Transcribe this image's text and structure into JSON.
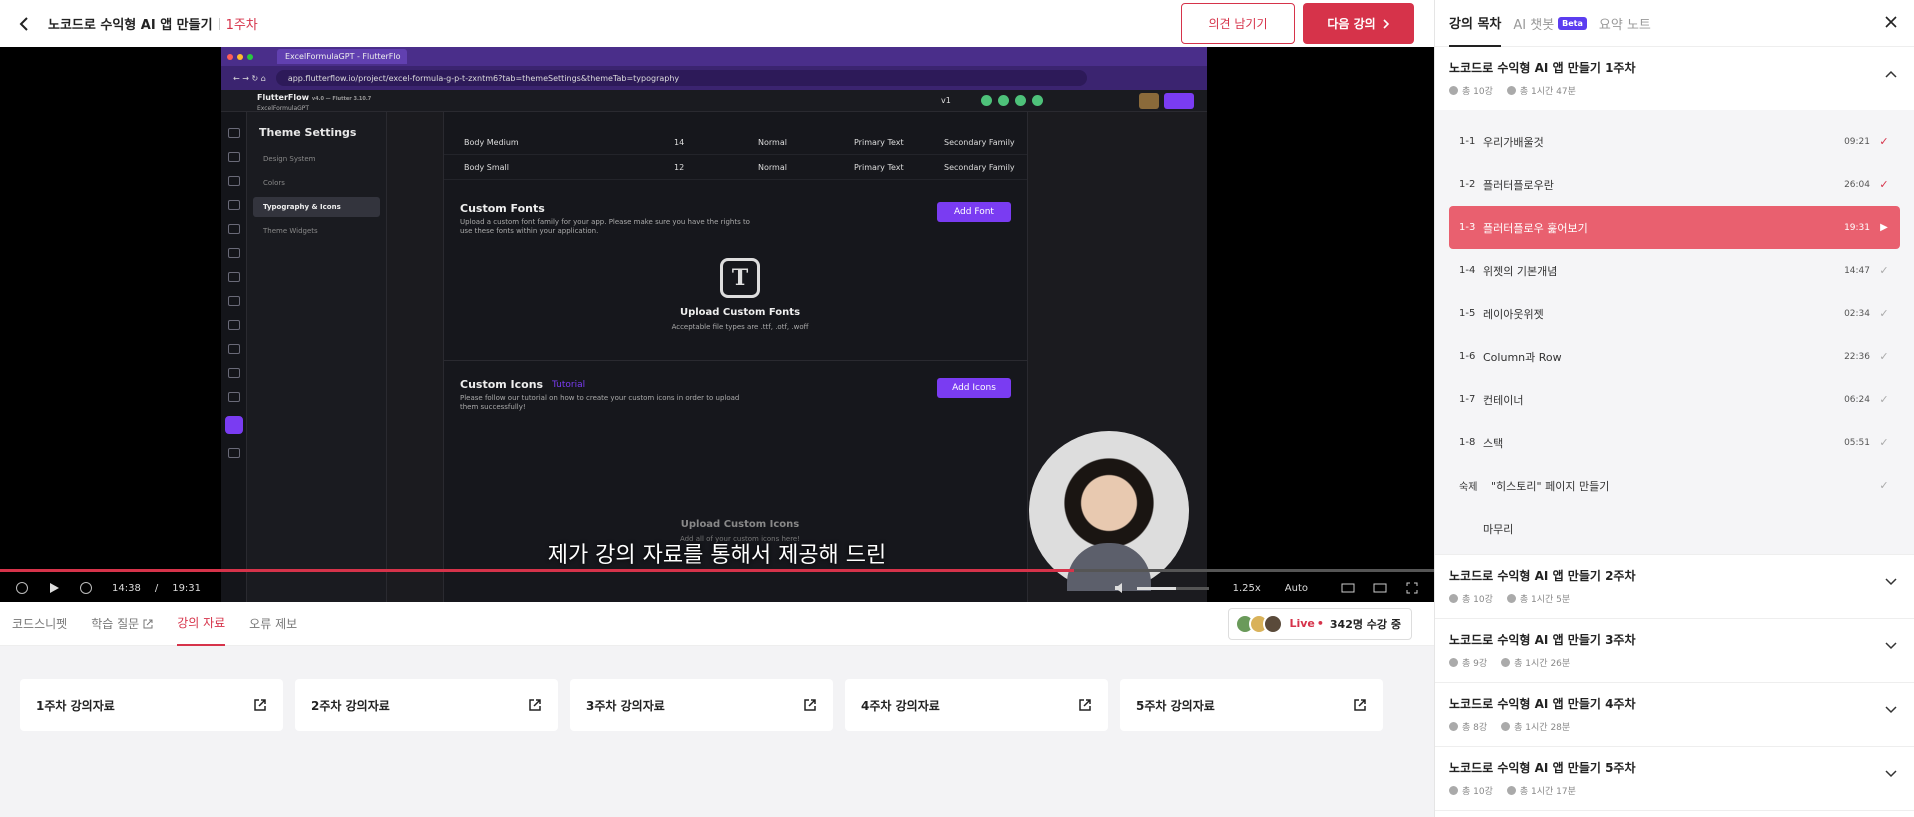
{
  "header": {
    "course_title": "노코드로 수익형 AI 앱 만들기",
    "week": "1주차",
    "feedback_btn": "의견 남기기",
    "next_btn": "다음 강의"
  },
  "video": {
    "browser_tab": "ExcelFormulaGPT - FlutterFlo",
    "url": "app.flutterflow.io/project/excel-formula-g-p-t-zxntm6?tab=themeSettings&themeTab=typography",
    "ff_brand": "FlutterFlow",
    "ff_version": "v4.0 — Flutter 3.10.7",
    "ff_project": "ExcelFormulaGPT",
    "version_tag": "v1",
    "theme_title": "Theme Settings",
    "side_items": [
      "Design System",
      "Colors",
      "Typography & Icons",
      "Theme Widgets"
    ],
    "rows": [
      {
        "name": "Body Medium",
        "size": "14",
        "weight": "Normal",
        "color": "Primary Text",
        "family": "Secondary Family"
      },
      {
        "name": "Body Small",
        "size": "12",
        "weight": "Normal",
        "color": "Primary Text",
        "family": "Secondary Family"
      }
    ],
    "custom_fonts_title": "Custom Fonts",
    "custom_fonts_desc": "Upload a custom font family for your app. Please make sure you have the rights to use these fonts within your application.",
    "add_font": "Add Font",
    "upload_fonts_title": "Upload Custom Fonts",
    "upload_fonts_desc": "Acceptable file types are .ttf, .otf, .woff",
    "custom_icons_title": "Custom Icons",
    "tutorial": "Tutorial",
    "custom_icons_desc": "Please follow our tutorial on how to create your custom icons in order to upload them successfully!",
    "add_icons": "Add Icons",
    "upload_icons_title": "Upload Custom Icons",
    "upload_icons_desc": "Add all of your custom icons here!",
    "subtitle": "제가 강의 자료를 통해서 제공해 드린",
    "current_time": "14:38",
    "time_sep": "/",
    "duration": "19:31",
    "progress": 0.749,
    "volume": 0.55,
    "speed": "1.25x",
    "quality": "Auto"
  },
  "tabs": [
    {
      "label": "코드스니펫"
    },
    {
      "label": "학습 질문"
    },
    {
      "label": "강의 자료"
    },
    {
      "label": "오류 제보"
    }
  ],
  "live": {
    "label": "Live",
    "dot": "•",
    "count": "342명 수강 중"
  },
  "materials": [
    "1주차 강의자료",
    "2주차 강의자료",
    "3주차 강의자료",
    "4주차 강의자료",
    "5주차 강의자료"
  ],
  "panel": {
    "tabs": {
      "toc": "강의 목차",
      "ai": "AI 챗봇",
      "beta": "Beta",
      "notes": "요약 노트"
    },
    "weeks": [
      {
        "title": "노코드로 수익형 AI 앱 만들기 1주차",
        "count": "총 10강",
        "time": "총 1시간 47분"
      },
      {
        "title": "노코드로 수익형 AI 앱 만들기 2주차",
        "count": "총 10강",
        "time": "총 1시간 5분"
      },
      {
        "title": "노코드로 수익형 AI 앱 만들기 3주차",
        "count": "총 9강",
        "time": "총 1시간 26분"
      },
      {
        "title": "노코드로 수익형 AI 앱 만들기 4주차",
        "count": "총 8강",
        "time": "총 1시간 28분"
      },
      {
        "title": "노코드로 수익형 AI 앱 만들기 5주차",
        "count": "총 10강",
        "time": "총 1시간 17분"
      }
    ],
    "lessons": [
      {
        "num": "1-1",
        "title": "우리가배울것",
        "dur": "09:21",
        "status": "done"
      },
      {
        "num": "1-2",
        "title": "플러터플로우란",
        "dur": "26:04",
        "status": "done"
      },
      {
        "num": "1-3",
        "title": "플러터플로우 훑어보기",
        "dur": "19:31",
        "status": "playing"
      },
      {
        "num": "1-4",
        "title": "위젯의 기본개념",
        "dur": "14:47",
        "status": "todo"
      },
      {
        "num": "1-5",
        "title": "레이아웃위젯",
        "dur": "02:34",
        "status": "todo"
      },
      {
        "num": "1-6",
        "title": "Column과 Row",
        "dur": "22:36",
        "status": "todo"
      },
      {
        "num": "1-7",
        "title": "컨테이너",
        "dur": "06:24",
        "status": "todo"
      },
      {
        "num": "1-8",
        "title": "스택",
        "dur": "05:51",
        "status": "todo"
      },
      {
        "num": "숙제",
        "title": "\"히스토리\" 페이지 만들기",
        "dur": "",
        "status": "todo"
      },
      {
        "num": "",
        "title": "마무리",
        "dur": "",
        "status": "none"
      }
    ]
  },
  "colors": {
    "accent": "#d6334a",
    "active_lesson": "#e9606f",
    "flutterflow_purple": "#7a3cf2",
    "beta": "#5b3df0"
  }
}
